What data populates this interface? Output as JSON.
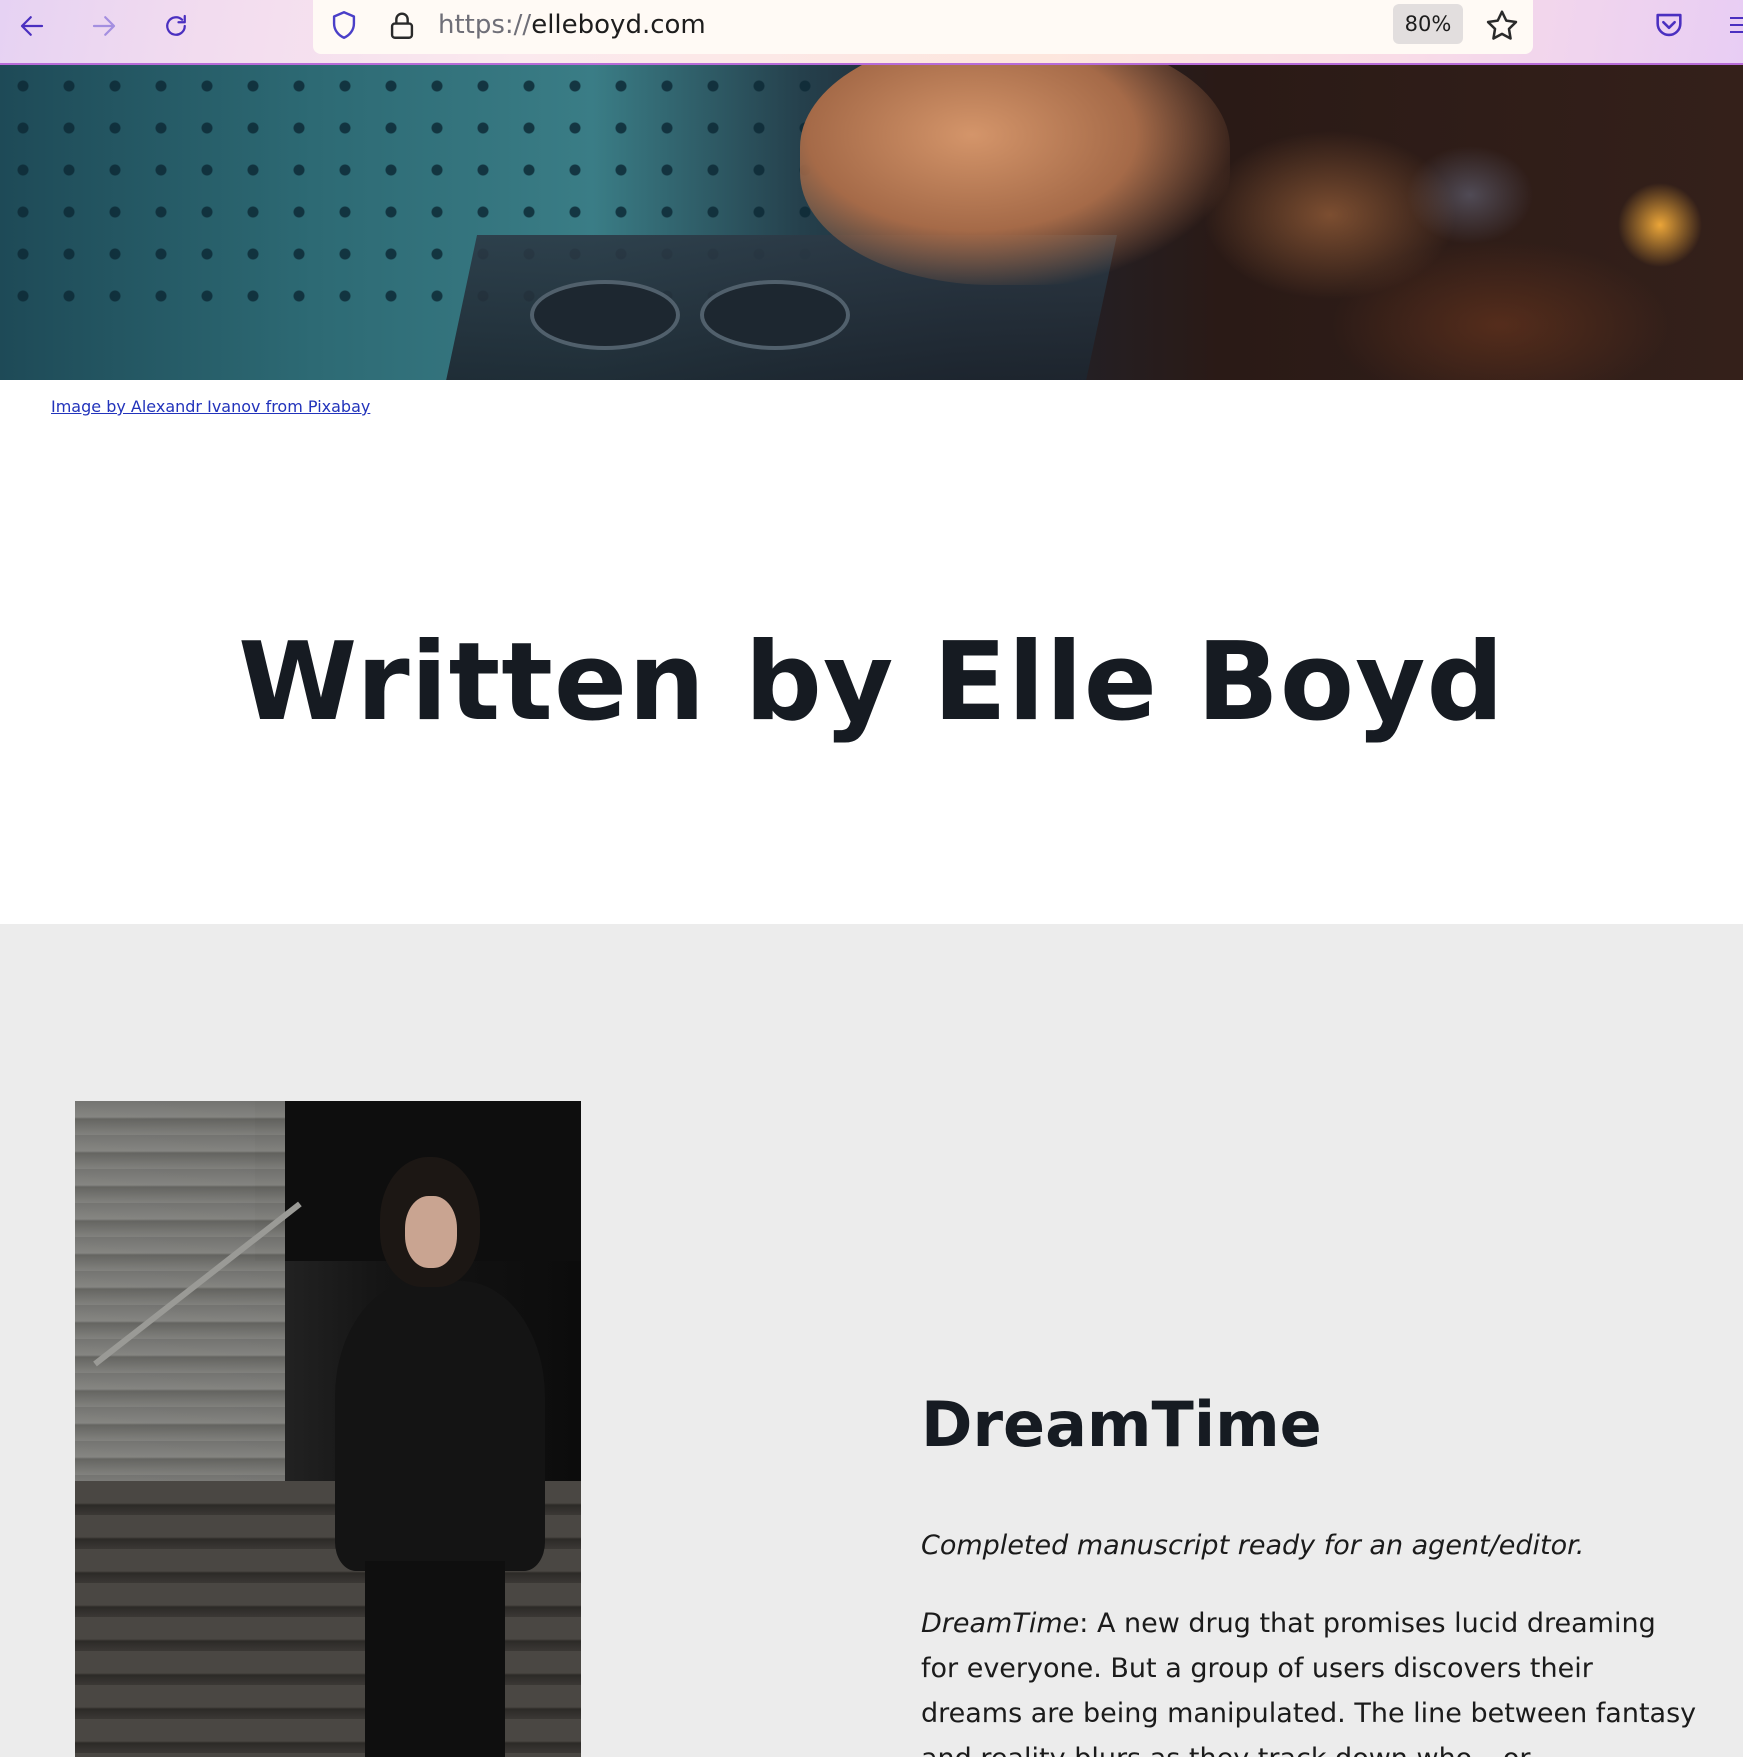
{
  "browser": {
    "url_scheme": "https://",
    "url_host": "elleboyd.com",
    "zoom": "80%",
    "icons": [
      "back-arrow-icon",
      "forward-arrow-icon",
      "reload-icon",
      "shield-icon",
      "lock-icon",
      "star-icon",
      "pocket-icon",
      "menu-icon"
    ]
  },
  "hero": {
    "credit_text": "Image by Alexandr Ivanov from Pixabay"
  },
  "page": {
    "title": "Written by Elle Boyd"
  },
  "book": {
    "title": "DreamTime",
    "status": "Completed manuscript ready for an agent/editor.",
    "desc_title": "DreamTime",
    "desc_body": ": A new drug that promises lucid dreaming for everyone. But a group of users discovers their dreams are being manipulated. The line between fantasy and reality blurs as they track down who – or"
  },
  "colors": {
    "link": "#2233bb",
    "heading": "#161b22",
    "section_bg": "#ececec",
    "toolbar_accent": "#5b3fd1"
  }
}
